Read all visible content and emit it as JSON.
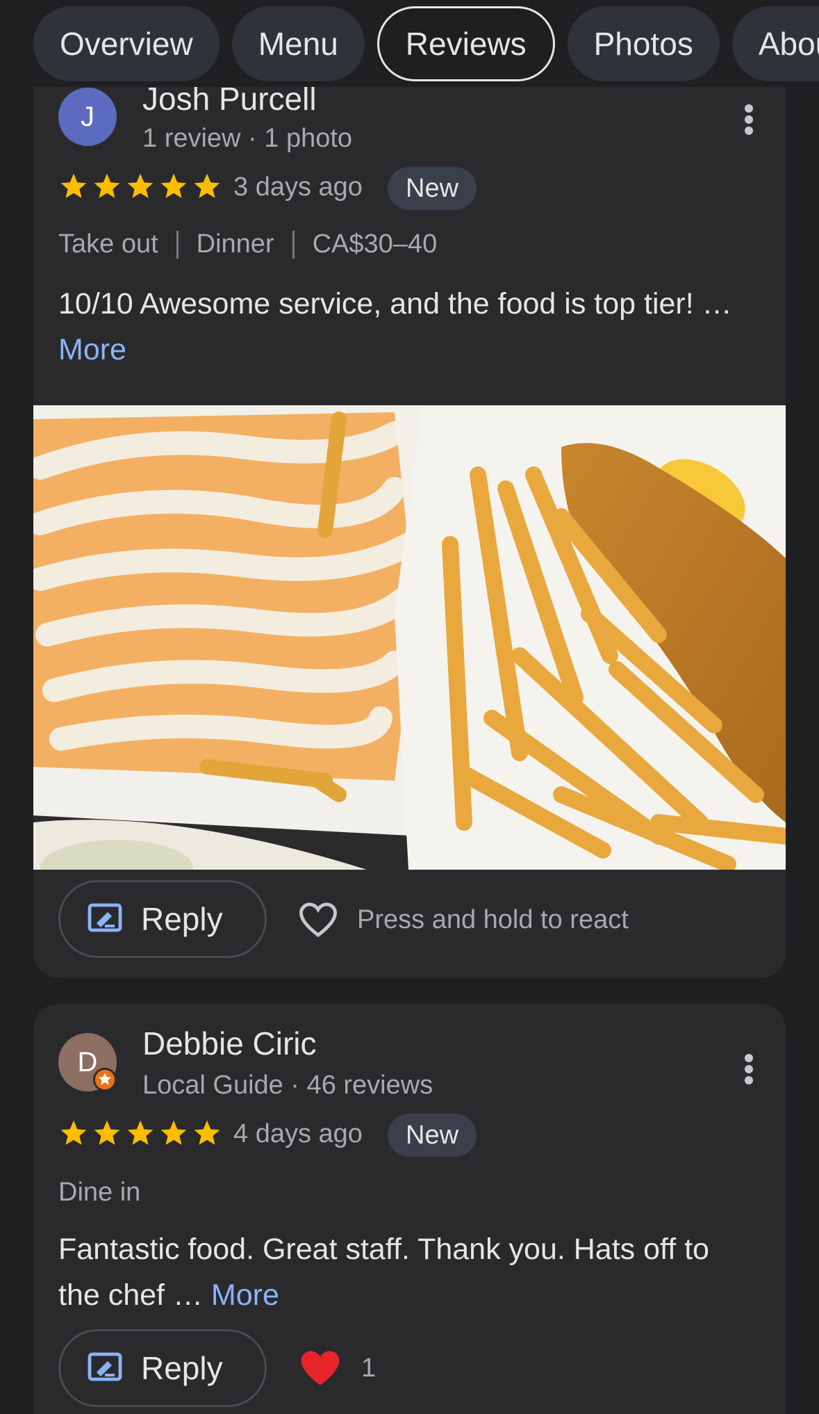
{
  "tabs": [
    {
      "label": "Overview"
    },
    {
      "label": "Menu"
    },
    {
      "label": "Reviews"
    },
    {
      "label": "Photos"
    },
    {
      "label": "About"
    }
  ],
  "active_tab": "Reviews",
  "reviews": [
    {
      "avatar_letter": "J",
      "avatar_color": "#5c6bc0",
      "author": "Josh Purcell",
      "meta": "1 review · 1 photo",
      "rating": 5,
      "when": "3 days ago",
      "badge": "New",
      "tags": [
        "Take out",
        "Dinner",
        "CA$30–40"
      ],
      "text": "10/10 Awesome service, and the food is top tier! …",
      "more": "More",
      "reply": "Reply",
      "react_hint": "Press and hold to react"
    },
    {
      "avatar_letter": "D",
      "avatar_color": "#8d6e63",
      "author": "Debbie Ciric",
      "meta": "Local Guide · 46 reviews",
      "rating": 5,
      "when": "4 days ago",
      "badge": "New",
      "tags": [
        "Dine in"
      ],
      "text": "Fantastic food. Great staff. Thank you. Hats off to the chef …",
      "more": "More",
      "reply": "Reply",
      "reaction_count": "1"
    }
  ],
  "colors": {
    "star": "#fbbc04",
    "link": "#8ab4f8",
    "background": "#1f1f21",
    "card": "#2a2a2d"
  }
}
